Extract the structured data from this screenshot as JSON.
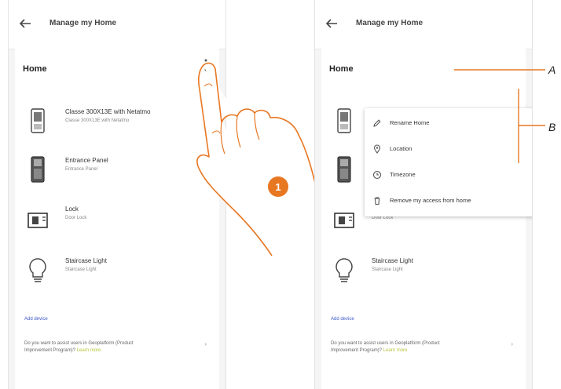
{
  "appbar_title": "Manage my Home",
  "section_title": "Home",
  "devices": [
    {
      "name": "Classe 300X13E with Netatmo",
      "sub": "Classe 300X13E with Netatmo"
    },
    {
      "name": "Entrance Panel",
      "sub": "Entrance Panel"
    },
    {
      "name": "Lock",
      "sub": "Door Lock"
    },
    {
      "name": "Staircase Light",
      "sub": "Staircase Light"
    }
  ],
  "link_text": "Add device",
  "info_text": "Do you want to assist users in Geoplatform (Product Improvement Program)?",
  "info_highlight": "Learn more",
  "menu": [
    {
      "label": "Rename Home",
      "icon": "pencil-icon"
    },
    {
      "label": "Location",
      "icon": "location-pin-icon"
    },
    {
      "label": "Timezone",
      "icon": "clock-icon"
    },
    {
      "label": "Remove my access from home",
      "icon": "trash-icon"
    }
  ],
  "step_badge": "1",
  "callouts": {
    "a": "A",
    "b": "B"
  },
  "colors": {
    "accent_orange": "#e87722",
    "link_blue": "#3d58c8",
    "highlight_green": "#b7c63a"
  }
}
